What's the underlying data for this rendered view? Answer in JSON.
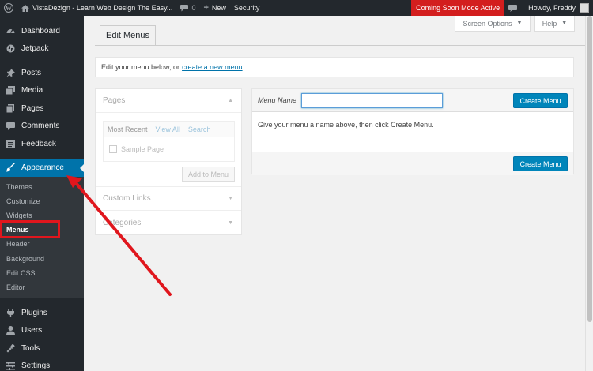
{
  "admin_bar": {
    "site_title": "VistaDezign - Learn Web Design The Easy...",
    "comments_count": "0",
    "new_label": "New",
    "security_label": "Security",
    "coming_soon_label": "Coming Soon Mode Active",
    "howdy_label": "Howdy, Freddy",
    "coming_soon_color": "#d31e1e"
  },
  "sidebar": {
    "items": [
      {
        "label": "Dashboard",
        "icon": "dashboard-icon"
      },
      {
        "label": "Jetpack",
        "icon": "jetpack-icon"
      },
      {
        "label": "Posts",
        "icon": "pin-icon"
      },
      {
        "label": "Media",
        "icon": "media-icon"
      },
      {
        "label": "Pages",
        "icon": "page-icon"
      },
      {
        "label": "Comments",
        "icon": "comment-icon"
      },
      {
        "label": "Feedback",
        "icon": "feedback-icon"
      },
      {
        "label": "Appearance",
        "icon": "brush-icon"
      },
      {
        "label": "Plugins",
        "icon": "plug-icon"
      },
      {
        "label": "Users",
        "icon": "user-icon"
      },
      {
        "label": "Tools",
        "icon": "wrench-icon"
      },
      {
        "label": "Settings",
        "icon": "settings-icon"
      }
    ],
    "appearance_submenu": [
      "Themes",
      "Customize",
      "Widgets",
      "Menus",
      "Header",
      "Background",
      "Edit CSS",
      "Editor"
    ],
    "accent_color": "#0073aa"
  },
  "header": {
    "tab_label": "Edit Menus",
    "screen_options_label": "Screen Options",
    "help_label": "Help"
  },
  "notice": {
    "text": "Edit your menu below, or",
    "link_text": "create a new menu",
    "suffix": "."
  },
  "panels": {
    "pages_title": "Pages",
    "tabs": [
      "Most Recent",
      "View All",
      "Search"
    ],
    "sample_page": "Sample Page",
    "add_to_menu_label": "Add to Menu",
    "custom_links_title": "Custom Links",
    "categories_title": "Categories"
  },
  "editor": {
    "menu_name_label": "Menu Name",
    "menu_name_value": "",
    "create_menu_label": "Create Menu",
    "instructions": "Give your menu a name above, then click Create Menu."
  }
}
